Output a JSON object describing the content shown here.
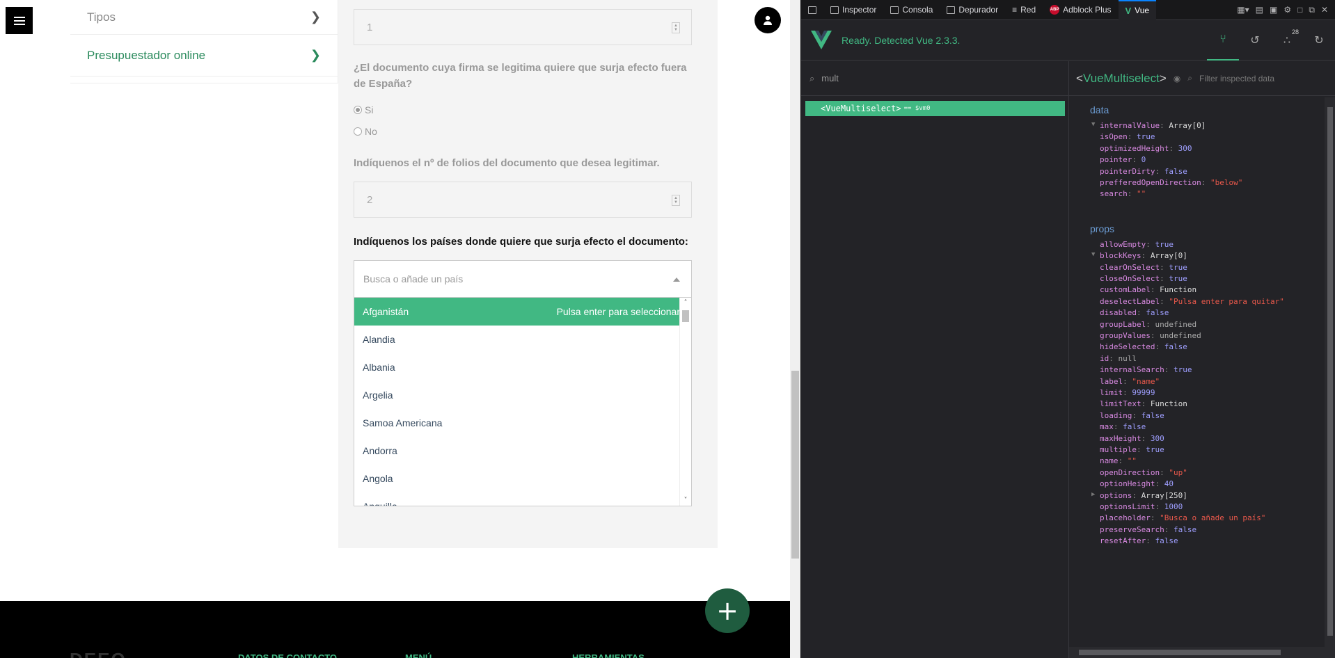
{
  "page": {
    "side_menu": [
      {
        "label": "Tipos",
        "active": false
      },
      {
        "label": "Presupuestador online",
        "active": true
      }
    ],
    "folios_first_value": "1",
    "q_foreign": "¿El documento cuya firma se legitima quiere que surja efecto fuera de España?",
    "radio_si": "Si",
    "radio_no": "No",
    "q_folios": "Indíquenos el nº de folios del documento que desea legitimar.",
    "folios_value": "2",
    "q_countries": "Indíquenos los países donde quiere que surja efecto el documento:",
    "multiselect": {
      "placeholder": "Busca o añade un país",
      "select_hint": "Pulsa enter para seleccionar",
      "options": [
        "Afganistán",
        "Alandia",
        "Albania",
        "Argelia",
        "Samoa Americana",
        "Andorra",
        "Angola",
        "Anguilla"
      ]
    },
    "fab_label": "+",
    "footer": {
      "logo": "DEEQ",
      "col1": "DATOS DE CONTACTO",
      "col2": "MENÚ",
      "col3": "HERRAMIENTAS"
    }
  },
  "devtools": {
    "tabs": [
      "Inspector",
      "Consola",
      "Depurador",
      "Red",
      "Adblock Plus",
      "Vue"
    ],
    "abp_label": "ABP",
    "status": "Ready. Detected Vue 2.3.3.",
    "badge_count": "28",
    "search_value": "mult",
    "tree_node": "<VueMultiselect>",
    "tree_node_vm": "== $vm0",
    "selected_component": "VueMultiselect",
    "filter_placeholder": "Filter inspected data",
    "data_title": "data",
    "props_title": "props",
    "data": [
      {
        "k": "internalValue",
        "v": "Array[0]",
        "t": "plain",
        "expand": "▼"
      },
      {
        "k": "isOpen",
        "v": "true",
        "t": "bool"
      },
      {
        "k": "optimizedHeight",
        "v": "300",
        "t": "num"
      },
      {
        "k": "pointer",
        "v": "0",
        "t": "num"
      },
      {
        "k": "pointerDirty",
        "v": "false",
        "t": "bool"
      },
      {
        "k": "prefferedOpenDirection",
        "v": "\"below\"",
        "t": "str"
      },
      {
        "k": "search",
        "v": "\"\"",
        "t": "str"
      }
    ],
    "props": [
      {
        "k": "allowEmpty",
        "v": "true",
        "t": "bool"
      },
      {
        "k": "blockKeys",
        "v": "Array[0]",
        "t": "plain",
        "expand": "▼"
      },
      {
        "k": "clearOnSelect",
        "v": "true",
        "t": "bool"
      },
      {
        "k": "closeOnSelect",
        "v": "true",
        "t": "bool"
      },
      {
        "k": "customLabel",
        "v": "Function",
        "t": "plain"
      },
      {
        "k": "deselectLabel",
        "v": "\"Pulsa enter para quitar\"",
        "t": "str"
      },
      {
        "k": "disabled",
        "v": "false",
        "t": "bool"
      },
      {
        "k": "groupLabel",
        "v": "undefined",
        "t": "und"
      },
      {
        "k": "groupValues",
        "v": "undefined",
        "t": "und"
      },
      {
        "k": "hideSelected",
        "v": "false",
        "t": "bool"
      },
      {
        "k": "id",
        "v": "null",
        "t": "und"
      },
      {
        "k": "internalSearch",
        "v": "true",
        "t": "bool"
      },
      {
        "k": "label",
        "v": "\"name\"",
        "t": "str"
      },
      {
        "k": "limit",
        "v": "99999",
        "t": "num"
      },
      {
        "k": "limitText",
        "v": "Function",
        "t": "plain"
      },
      {
        "k": "loading",
        "v": "false",
        "t": "bool"
      },
      {
        "k": "max",
        "v": "false",
        "t": "bool"
      },
      {
        "k": "maxHeight",
        "v": "300",
        "t": "num"
      },
      {
        "k": "multiple",
        "v": "true",
        "t": "bool"
      },
      {
        "k": "name",
        "v": "\"\"",
        "t": "str"
      },
      {
        "k": "openDirection",
        "v": "\"up\"",
        "t": "str"
      },
      {
        "k": "optionHeight",
        "v": "40",
        "t": "num"
      },
      {
        "k": "options",
        "v": "Array[250]",
        "t": "plain",
        "expand": "▶"
      },
      {
        "k": "optionsLimit",
        "v": "1000",
        "t": "num"
      },
      {
        "k": "placeholder",
        "v": "\"Busca o añade un país\"",
        "t": "str"
      },
      {
        "k": "preserveSearch",
        "v": "false",
        "t": "bool"
      },
      {
        "k": "resetAfter",
        "v": "false",
        "t": "bool"
      }
    ]
  }
}
